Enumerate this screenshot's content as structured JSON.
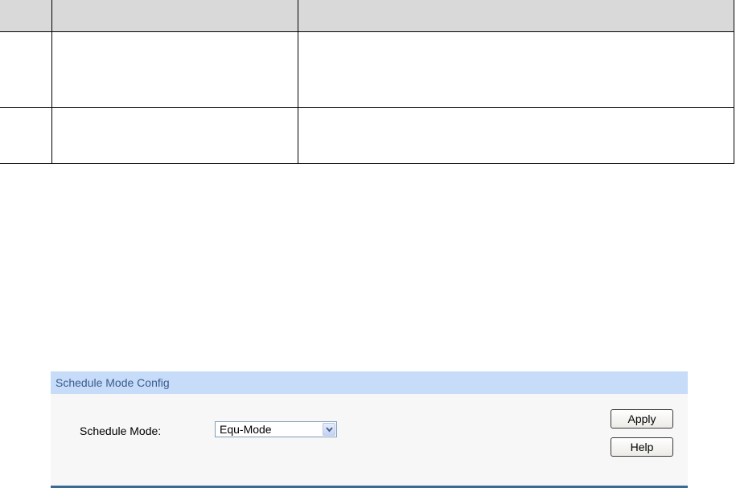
{
  "panel": {
    "title": "Schedule Mode Config",
    "field_label": "Schedule Mode:",
    "select": {
      "selected": "Equ-Mode"
    },
    "buttons": {
      "apply": "Apply",
      "help": "Help"
    }
  },
  "colors": {
    "panel_header_bg": "#c6dcf8",
    "panel_header_text": "#3b5c8e",
    "table_header_bg": "#d9d9d9",
    "footer_line": "#3a6a94"
  },
  "icons": {
    "select_arrow": "chevron-down-icon"
  }
}
